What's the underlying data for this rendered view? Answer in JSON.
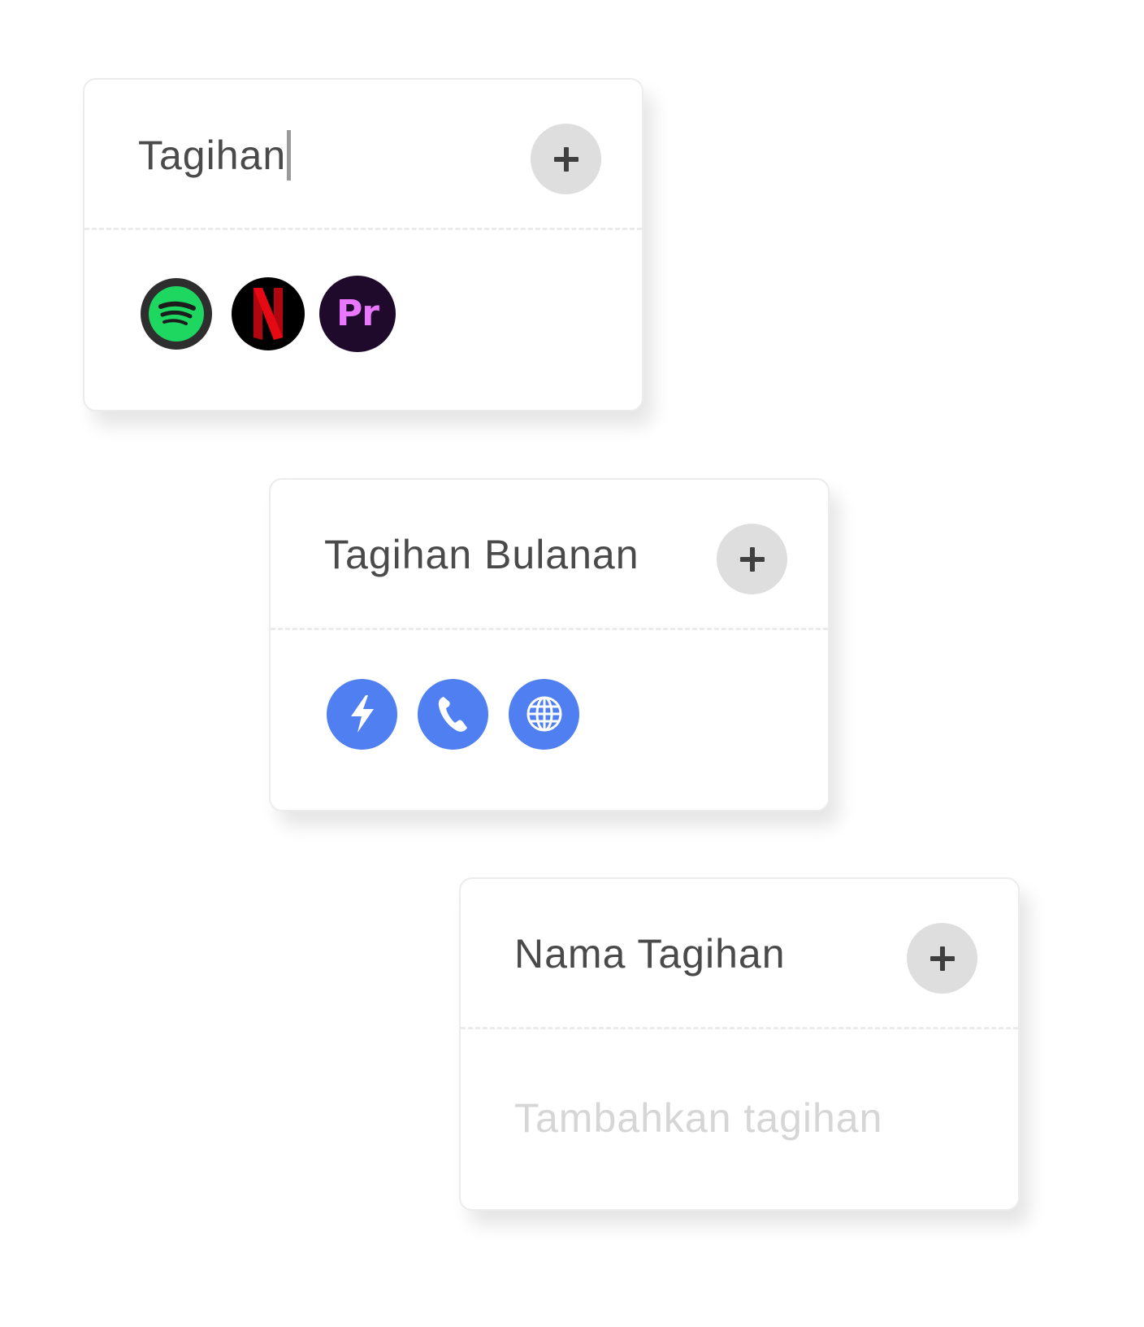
{
  "cards": [
    {
      "title": "Tagihan",
      "add_button": "plus-icon",
      "icons": [
        "spotify-icon",
        "netflix-icon",
        "premiere-pro-icon"
      ],
      "premiere_label": "Pr"
    },
    {
      "title": "Tagihan Bulanan",
      "add_button": "plus-icon",
      "icons": [
        "lightning-icon",
        "phone-icon",
        "globe-icon"
      ]
    },
    {
      "title": "Nama Tagihan",
      "add_button": "plus-icon",
      "placeholder": "Tambahkan tagihan"
    }
  ],
  "colors": {
    "accent_blue": "#4f7ff0",
    "spotify_green": "#1ed760",
    "netflix_red": "#e50914",
    "premiere_pink": "#ea77ff",
    "add_button_bg": "#dedede",
    "text": "#4a4a4a",
    "placeholder": "#d6d6d6"
  }
}
